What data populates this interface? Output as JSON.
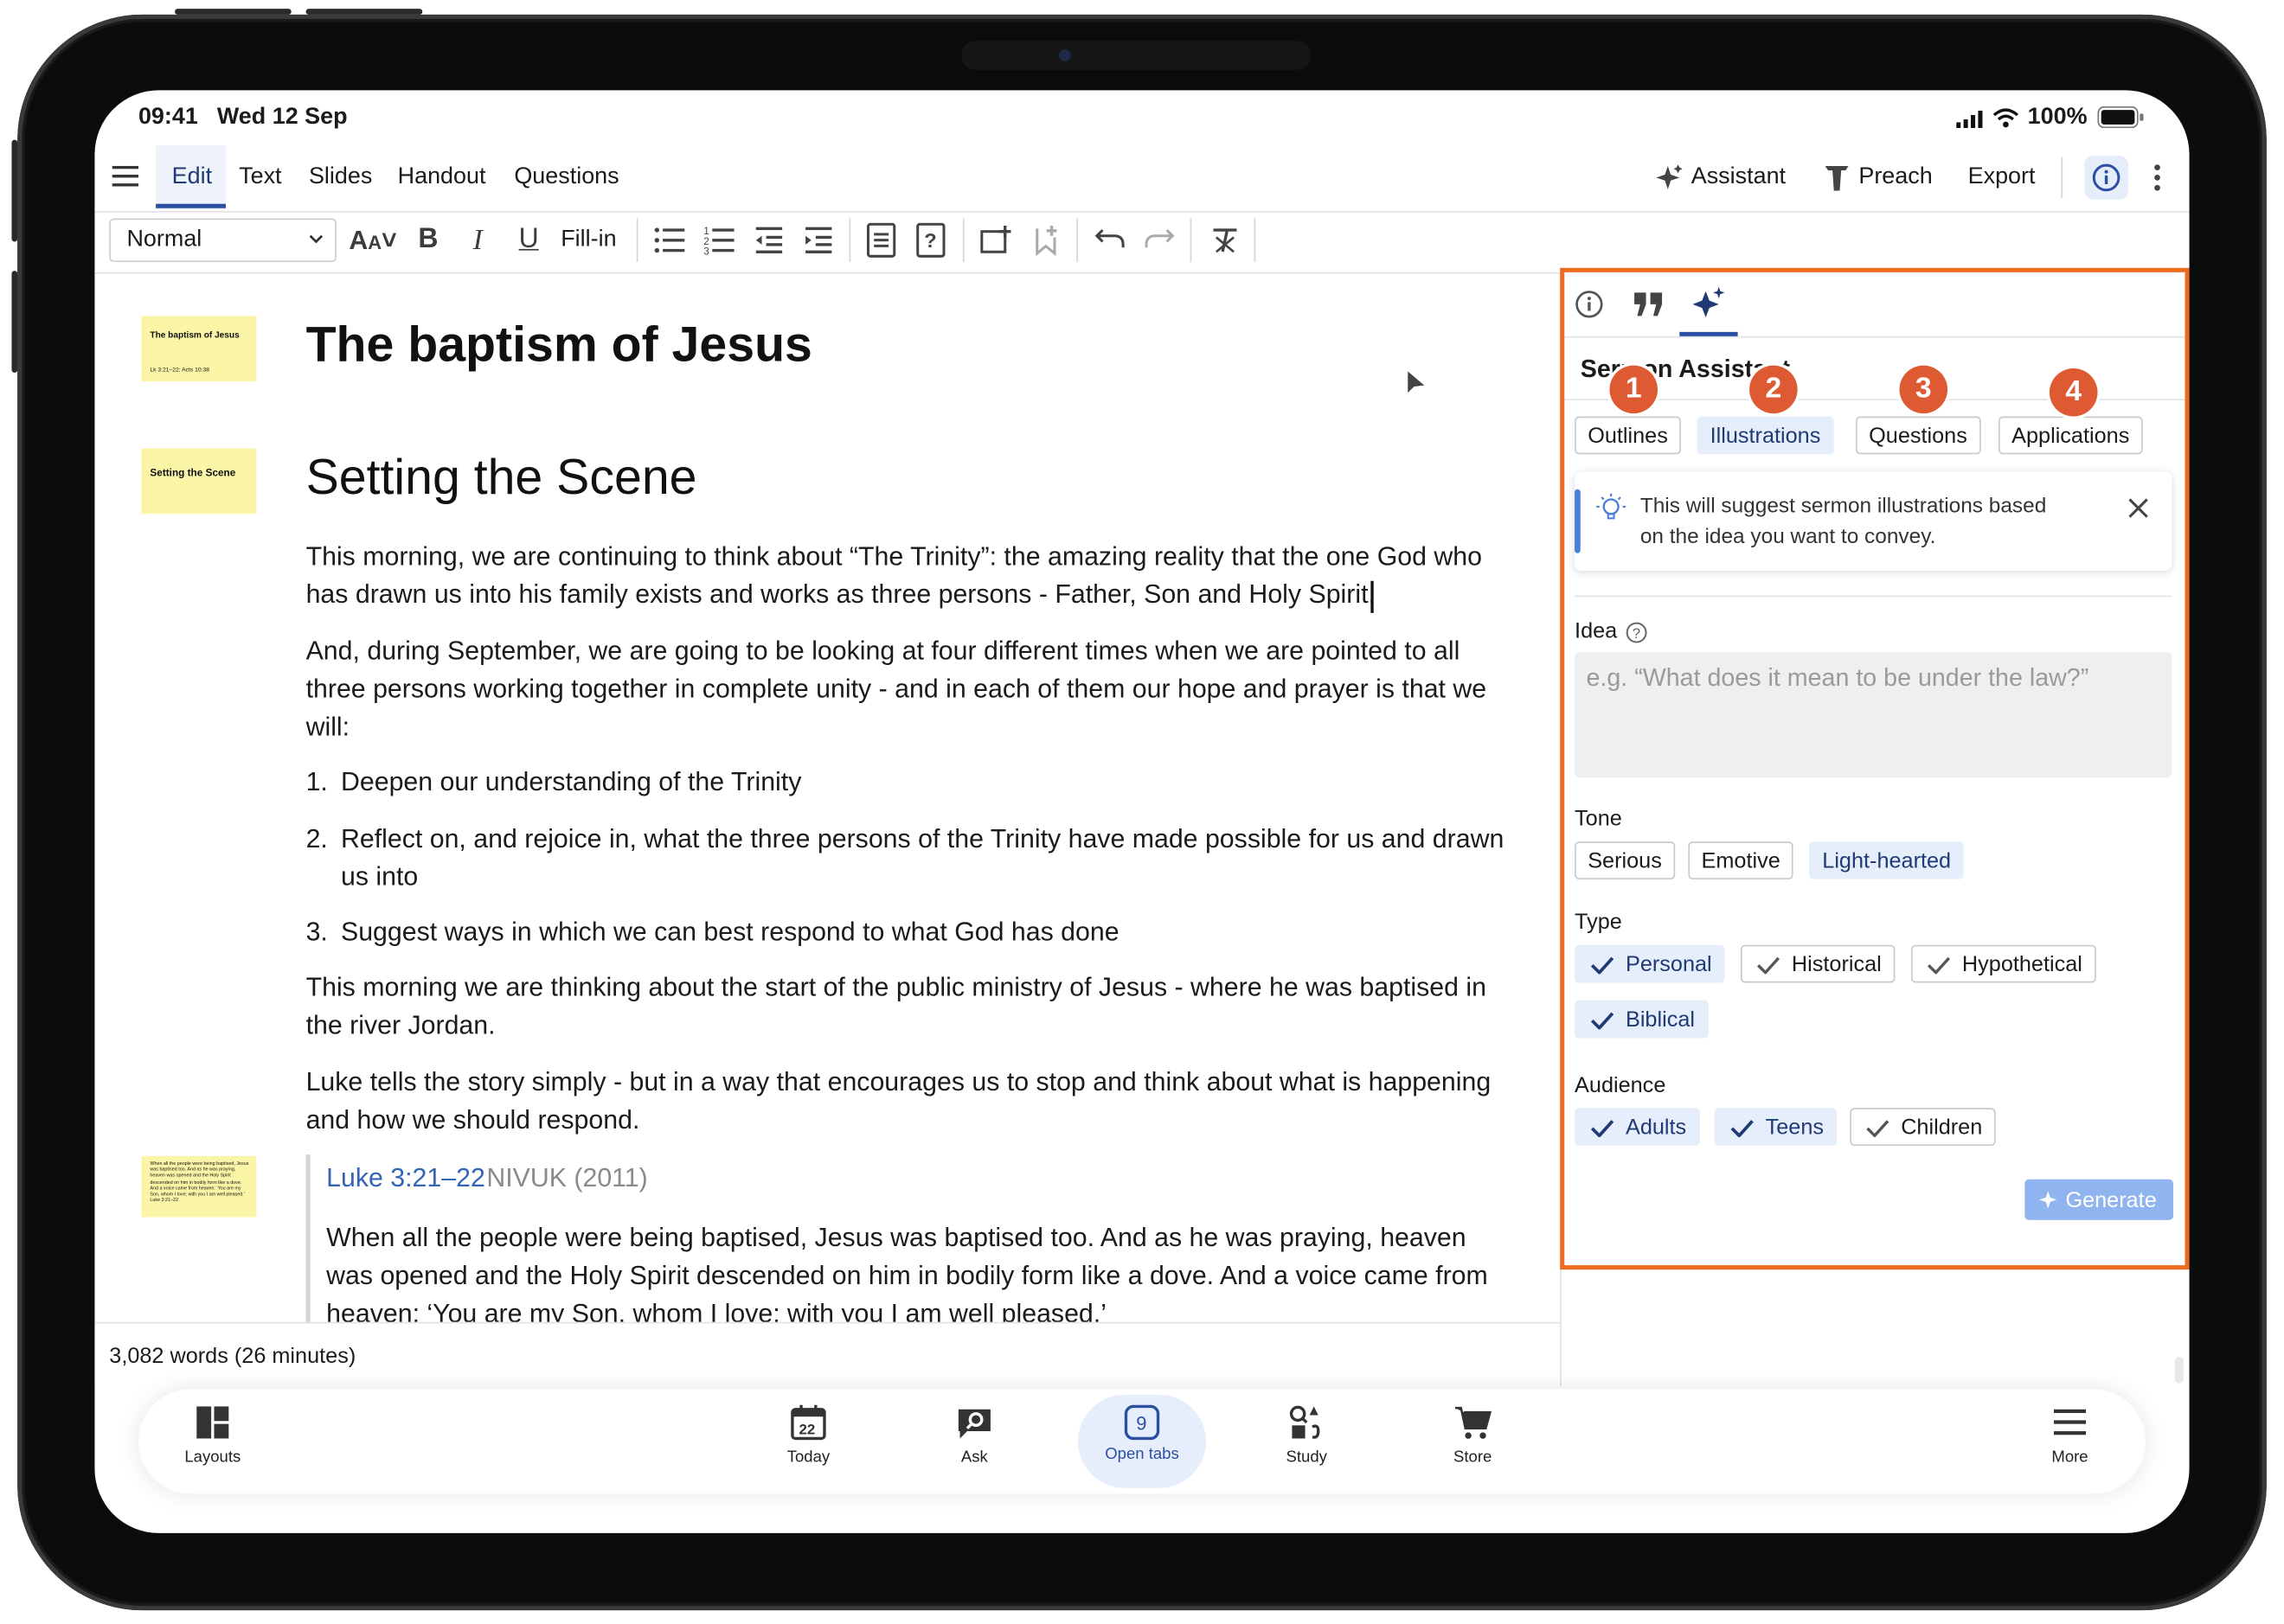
{
  "status_bar": {
    "time": "09:41",
    "date": "Wed 12 Sep",
    "battery": "100%"
  },
  "menu": {
    "items": [
      "Edit",
      "Text",
      "Slides",
      "Handout",
      "Questions"
    ],
    "active": "Edit",
    "assistant_label": "Assistant",
    "preach_label": "Preach",
    "export_label": "Export"
  },
  "toolbar": {
    "style_select": "Normal",
    "fill_in_label": "Fill-in"
  },
  "document": {
    "title": "The baptism of Jesus",
    "thumb_title": {
      "heading": "The baptism of Jesus",
      "sub": "Lk 3:21–22; Acts 10:38"
    },
    "section_heading": "Setting the Scene",
    "thumb_section": "Setting the Scene",
    "paragraphs": {
      "p1_l1": "This morning, we are continuing to think about “The Trinity”: the amazing reality that the one God who",
      "p1_l2": "has drawn us into his family exists and works as three persons - Father, Son and Holy Spirit.",
      "p2_l1": "And, during September, we are going to be looking at four different times when we are pointed to all",
      "p2_l2": "three persons working together in complete unity - and in each of them our hope and prayer is that we",
      "p2_l3": "will:",
      "li1": "Deepen our understanding of the Trinity",
      "li2_l1": "Reflect on, and rejoice in, what the three persons of the Trinity have made possible for us and drawn",
      "li2_l2": "us into",
      "li3": "Suggest ways in which we can best respond to what God has done",
      "p3_l1": "This morning we are thinking about the start of the public ministry of Jesus - where he was  baptised in",
      "p3_l2": "the river Jordan.",
      "p4_l1": "Luke tells the story simply - but in a way that encourages us to stop and think about what is happening",
      "p4_l2": "and how we should respond."
    },
    "list_numbers": [
      "1.",
      "2.",
      "3."
    ],
    "scripture": {
      "reference": "Luke 3:21–22",
      "version": "NIVUK (2011)",
      "l1": "When all the people were being baptised, Jesus was baptised too. And as he was praying, heaven",
      "l2": "was opened and the Holy Spirit descended on him in bodily form like a dove. And a voice came from",
      "l3": "heaven: ‘You are my Son, whom I love; with you I am well pleased.’"
    },
    "thumb_scripture": "When all the people were being baptised, Jesus was baptised too. And as he was praying, heaven was opened and the Holy Spirit descended on him in bodily form like a dove. And a voice came from heaven: ‘You are my Son, whom I love; with you I am well pleased.’ Luke 3:21–22",
    "word_count": "3,082 words (26 minutes)"
  },
  "assistant_panel": {
    "title": "Sermon Assistant",
    "tabs": [
      "Outlines",
      "Illustrations",
      "Questions",
      "Applications"
    ],
    "active_tab": "Illustrations",
    "badges": [
      "1",
      "2",
      "3",
      "4"
    ],
    "hint_l1": "This will suggest sermon illustrations based",
    "hint_l2": "on the idea you want to convey.",
    "idea_label": "Idea",
    "idea_placeholder": "e.g. “What does it mean to be under the law?”",
    "tone_label": "Tone",
    "tone_options": [
      "Serious",
      "Emotive",
      "Light-hearted"
    ],
    "tone_selected": "Light-hearted",
    "type_label": "Type",
    "type_options": [
      "Personal",
      "Historical",
      "Hypothetical",
      "Biblical"
    ],
    "audience_label": "Audience",
    "audience_options": [
      "Adults",
      "Teens",
      "Children"
    ],
    "generate_label": "Generate",
    "highlight_color": "#ec6b1e"
  },
  "bottom_nav": {
    "layouts": "Layouts",
    "today": "Today",
    "today_day": "22",
    "ask": "Ask",
    "open_tabs": "Open tabs",
    "open_tabs_count": "9",
    "study": "Study",
    "store": "Store",
    "more": "More"
  },
  "colors": {
    "accent": "#2b4fa3",
    "link": "#3465b5",
    "thumb_yellow": "#fbf6a7",
    "badge": "#de5a32"
  }
}
